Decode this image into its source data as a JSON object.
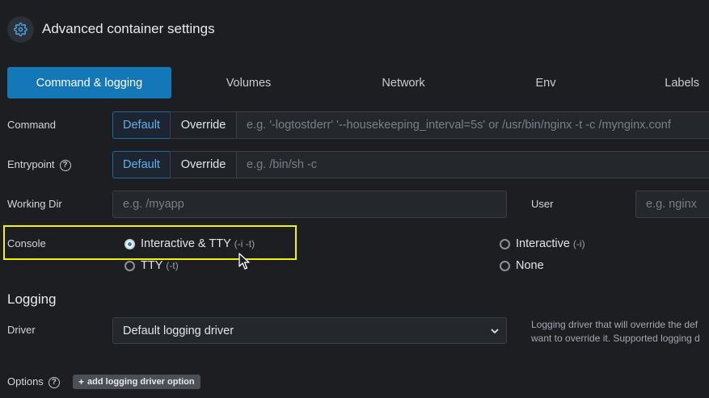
{
  "header": {
    "title": "Advanced container settings",
    "icon": "gear-icon"
  },
  "tabs": [
    {
      "label": "Command & logging",
      "active": true
    },
    {
      "label": "Volumes"
    },
    {
      "label": "Network"
    },
    {
      "label": "Env"
    },
    {
      "label": "Labels"
    }
  ],
  "command": {
    "label": "Command",
    "default_label": "Default",
    "override_label": "Override",
    "placeholder": "e.g. '-logtostderr' '--housekeeping_interval=5s' or /usr/bin/nginx -t -c /mynginx.conf"
  },
  "entrypoint": {
    "label": "Entrypoint",
    "help_icon": "question-circle-icon",
    "default_label": "Default",
    "override_label": "Override",
    "placeholder": "e.g. /bin/sh -c"
  },
  "working_dir": {
    "label": "Working Dir",
    "placeholder": "e.g. /myapp"
  },
  "user": {
    "label": "User",
    "placeholder": "e.g. nginx"
  },
  "console": {
    "label": "Console",
    "options": [
      {
        "label": "Interactive & TTY",
        "hint": "(-i -t)",
        "selected": true
      },
      {
        "label": "Interactive",
        "hint": "(-i)",
        "selected": false
      },
      {
        "label": "TTY",
        "hint": "(-t)",
        "selected": false
      },
      {
        "label": "None",
        "hint": "",
        "selected": false
      }
    ]
  },
  "logging": {
    "title": "Logging",
    "driver_label": "Driver",
    "driver_value": "Default logging driver",
    "help_line1": "Logging driver that will override the def",
    "help_line2": "want to override it. Supported logging d",
    "options_label": "Options",
    "add_option_label": "add logging driver option"
  },
  "colors": {
    "accent": "#1477b7",
    "highlight": "#f2f20a",
    "background": "#1c1e22"
  }
}
